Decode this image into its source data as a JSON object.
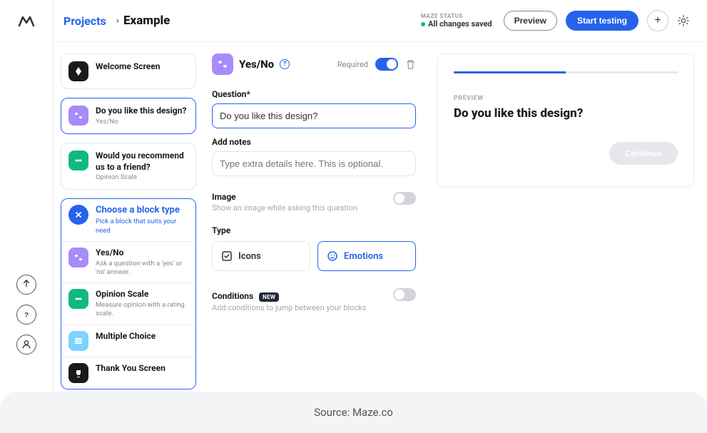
{
  "breadcrumb": {
    "parent": "Projects",
    "current": "Example"
  },
  "status": {
    "label": "MAZE STATUS",
    "value": "All changes saved"
  },
  "header": {
    "preview": "Preview",
    "start": "Start testing"
  },
  "blocks": {
    "welcome": {
      "title": "Welcome Screen"
    },
    "yesno": {
      "title": "Do you like this design?",
      "sub": "Yes/No"
    },
    "opinion": {
      "title": "Would you recommend us to a friend?",
      "sub": "Opinion Scale"
    }
  },
  "dropdown": {
    "header": {
      "title": "Choose a block type",
      "sub": "Pick a block that suits your need"
    },
    "items": [
      {
        "title": "Yes/No",
        "sub": "Ask a question with a 'yes' or 'no' answer."
      },
      {
        "title": "Opinion Scale",
        "sub": "Measure opinion with a rating scale."
      },
      {
        "title": "Multiple Choice",
        "sub": ""
      },
      {
        "title": "Thank You Screen",
        "sub": ""
      }
    ]
  },
  "editor": {
    "title": "Yes/No",
    "required_label": "Required",
    "question_label": "Question*",
    "question_value": "Do you like this design?",
    "notes_label": "Add notes",
    "notes_placeholder": "Type extra details here. This is optional.",
    "image_label": "Image",
    "image_sub": "Show an image while asking this question",
    "type_label": "Type",
    "type_icons": "Icons",
    "type_emotions": "Emotions",
    "cond_label": "Conditions",
    "cond_badge": "NEW",
    "cond_sub": "Add conditions to jump between your blocks"
  },
  "preview": {
    "label": "PREVIEW",
    "question": "Do you like this design?",
    "continue": "Continue",
    "progress_pct": 50
  },
  "source": "Source: Maze.co"
}
